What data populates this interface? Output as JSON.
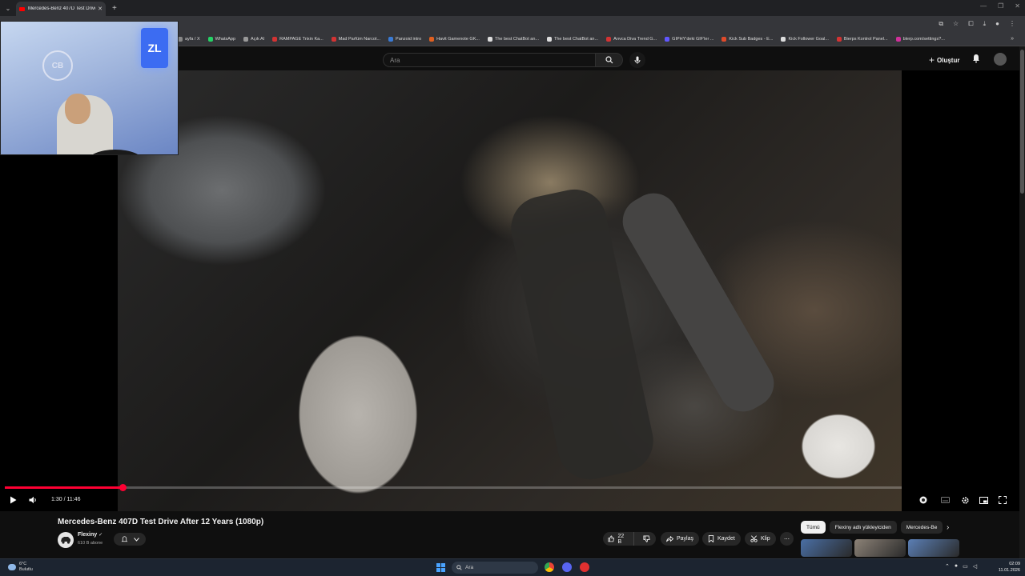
{
  "browser": {
    "tab_title": "Mercedes-Benz 407D Test Drive",
    "tab_close": "✕",
    "new_tab": "+",
    "bookmarks": [
      {
        "label": "ayfa / X",
        "color": "#888888"
      },
      {
        "label": "WhatsApp",
        "color": "#25d366"
      },
      {
        "label": "Açık AI",
        "color": "#999999"
      },
      {
        "label": "RAMPAGE Trixin Ka...",
        "color": "#d33333"
      },
      {
        "label": "Mad Parfüm Narcot...",
        "color": "#d33333"
      },
      {
        "label": "Panzoid intro",
        "color": "#3a7bd5"
      },
      {
        "label": "Havit Gamenote GK...",
        "color": "#e06020"
      },
      {
        "label": "The best ChatBot an...",
        "color": "#dddddd"
      },
      {
        "label": "The best ChatBot an...",
        "color": "#dddddd"
      },
      {
        "label": "Arıvca Diva Trend G...",
        "color": "#d33333"
      },
      {
        "label": "GIPHY'deki GIF'ler ...",
        "color": "#6157ff"
      },
      {
        "label": "Kick Sub Badges - E...",
        "color": "#e04a2a"
      },
      {
        "label": "Kick Follower Goal...",
        "color": "#dddddd"
      },
      {
        "label": "Bierps Kontrol Panel...",
        "color": "#d33333"
      },
      {
        "label": "blerp.com/settings?...",
        "color": "#d0309a"
      }
    ],
    "bookmarks_more": "»"
  },
  "youtube": {
    "search_placeholder": "Ara",
    "create_label": "Oluştur",
    "create_plus": "+"
  },
  "webcam": {
    "logo_text": "CB",
    "sign_text": "ZL"
  },
  "player": {
    "progress_fraction": 0.131,
    "time_display": "1:30 / 11:46"
  },
  "video": {
    "title": "Mercedes-Benz 407D Test Drive After 12 Years (1080p)",
    "channel_name": "Flexiny",
    "verified_mark": "✓",
    "subscribers": "610 B abone",
    "likes": "22 B",
    "share_label": "Paylaş",
    "save_label": "Kaydet",
    "clip_label": "Klip",
    "more_dots": "⋯"
  },
  "chips": [
    "Tümü",
    "Flexiny adlı yükleyiciden",
    "Mercedes-Be"
  ],
  "chip_next": "›",
  "thumbnails": [
    "#4a6fa5",
    "#8c8277",
    "#5b7fb5"
  ],
  "taskbar": {
    "weather_temp": "6°C",
    "weather_desc": "Bulutlu",
    "search_label": "Ara",
    "time": "02:09",
    "date": "11.01.2026"
  }
}
